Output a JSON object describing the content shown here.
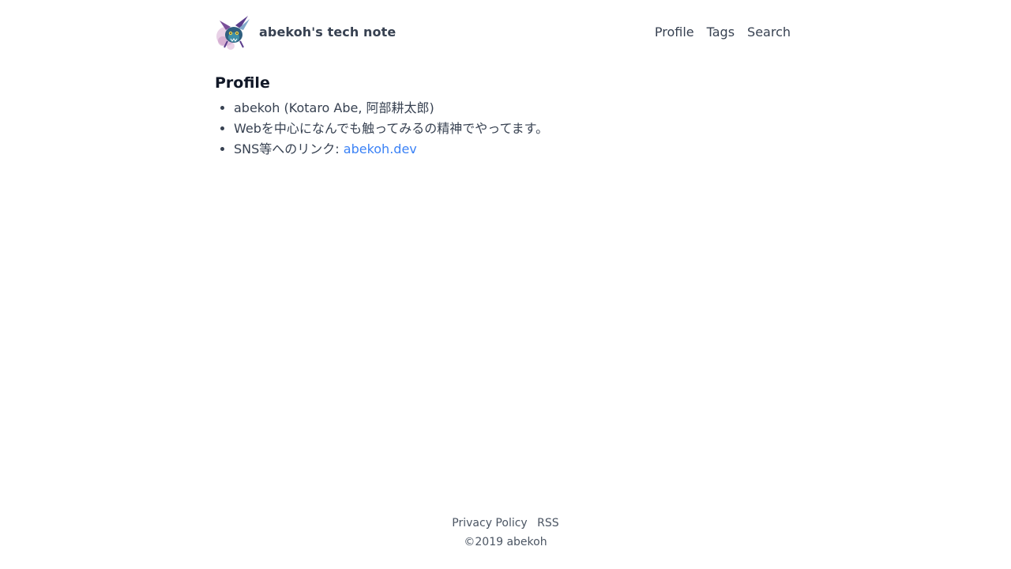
{
  "header": {
    "site_title": "abekoh's tech note",
    "logo_icon": "bat-avatar-icon",
    "nav": [
      {
        "label": "Profile"
      },
      {
        "label": "Tags"
      },
      {
        "label": "Search"
      }
    ]
  },
  "main": {
    "heading": "Profile",
    "items": [
      {
        "text": "abekoh (Kotaro Abe, 阿部耕太郎)"
      },
      {
        "text": "Webを中心になんでも触ってみるの精神でやってます。"
      },
      {
        "text": "SNS等へのリンク: ",
        "link": "abekoh.dev"
      }
    ]
  },
  "footer": {
    "links": [
      {
        "label": "Privacy Policy"
      },
      {
        "label": "RSS"
      }
    ],
    "copyright": "©2019 abekoh"
  },
  "colors": {
    "text": "#374151",
    "heading": "#111827",
    "link": "#3b82f6",
    "footer_text": "#4b5563",
    "background": "#ffffff"
  }
}
